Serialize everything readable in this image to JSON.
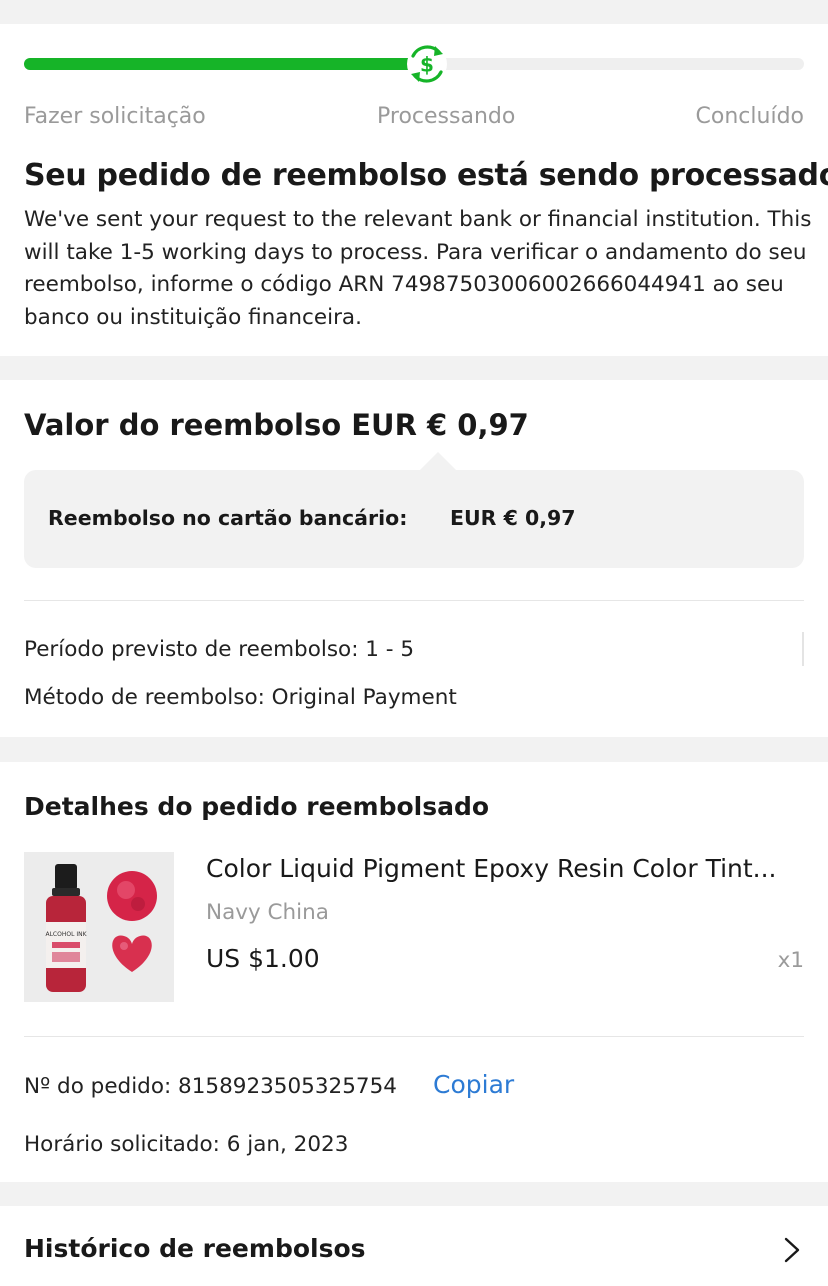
{
  "progress": {
    "value_percent": 52,
    "icon": "dollar-refresh-icon",
    "steps": [
      "Fazer solicitação",
      "Processando",
      "Concluído"
    ],
    "colors": {
      "fill": "#16b428",
      "track": "#efefef"
    }
  },
  "status": {
    "title": "Seu pedido de reembolso está sendo processado",
    "description": "We've sent your request to the relevant bank or financial institution. This will take 1-5 working days to process. Para verificar o andamento do seu reembolso, informe o código ARN 74987503006002666044941 ao seu banco ou instituição financeira."
  },
  "refund": {
    "title": "Valor do reembolso EUR € 0,97",
    "breakdown_label": "Reembolso no cartão bancário:",
    "breakdown_value": "EUR € 0,97",
    "period": "Período previsto de reembolso: 1 - 5",
    "method": "Método de reembolso: Original Payment"
  },
  "order": {
    "title": "Detalhes do pedido reembolsado",
    "product": {
      "name": "Color Liquid Pigment Epoxy Resin Color Tint...",
      "seller": "Navy China",
      "price": "US $1.00",
      "quantity": "x1",
      "image_label": "ALCOHOL INK"
    },
    "order_number": "Nº do pedido: 8158923505325754",
    "copy_label": "Copiar",
    "requested_time": "Horário solicitado: 6 jan, 2023",
    "link_color": "#2d7bd4"
  },
  "history": {
    "title": "Histórico de reembolsos",
    "icon": "chevron-right-icon"
  }
}
